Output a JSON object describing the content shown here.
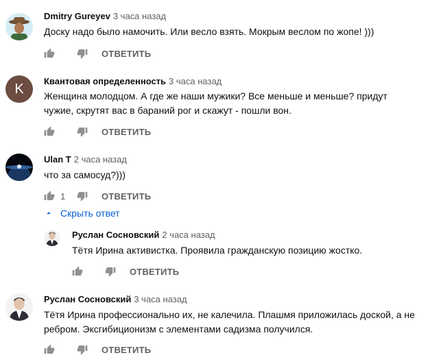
{
  "comments": [
    {
      "author": "Dmitry Gureyev",
      "time": "3 часа назад",
      "text": "Доску надо было намочить. Или весло взять. Мокрым веслом по жопе! )))",
      "likes": "",
      "reply_label": "ОТВЕТИТЬ"
    },
    {
      "author": "Квантовая определенность",
      "time": "3 часа назад",
      "avatar_letter": "K",
      "avatar_color": "#6d4c41",
      "text_line1": "Женщина молодцом. А где же наши мужики? Все меньше и меньше? придут",
      "text_line2": "чужие, скрутят вас в бараний рог и скажут - пошли вон.",
      "likes": "",
      "reply_label": "ОТВЕТИТЬ"
    },
    {
      "author": "Ulan T",
      "time": "2 часа назад",
      "text": "что за самосуд?)))",
      "likes": "1",
      "reply_label": "ОТВЕТИТЬ",
      "hide_replies_label": "Скрыть ответ",
      "reply": {
        "author": "Руслан Сосновский",
        "time": "2 часа назад",
        "text": "Тётя Ирина активистка. Проявила гражданскую позицию жостко.",
        "likes": "",
        "reply_label": "ОТВЕТИТЬ"
      }
    },
    {
      "author": "Руслан Сосновский",
      "time": "3 часа назад",
      "text_line1": "Тётя Ирина профессионально их, не калечила. Плашмя приложилась доской, а не",
      "text_line2": "ребром. Эксгибиционизм с элементами садизма получился.",
      "likes": "",
      "reply_label": "ОТВЕТИТЬ"
    }
  ],
  "colors": {
    "link_blue": "#065fd4",
    "secondary_text": "#606060",
    "icon_gray": "#909090"
  },
  "icons": [
    "thumb-up-icon",
    "thumb-down-icon",
    "chevron-up-icon"
  ]
}
